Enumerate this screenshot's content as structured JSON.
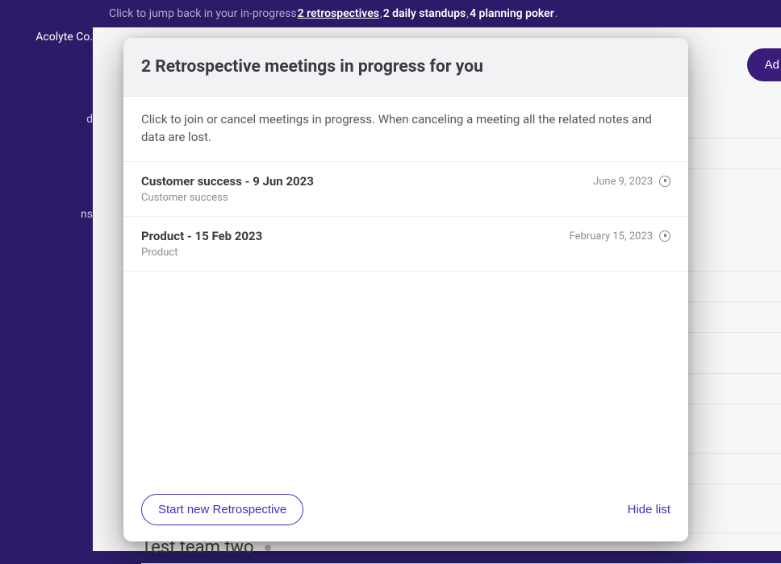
{
  "sidebar": {
    "org": "Acolyte Co.",
    "items": [
      "d",
      "ns"
    ]
  },
  "banner": {
    "prefix": "Click to jump back in your in-progress ",
    "retro": "2 retrospectives",
    "sep1": ", ",
    "standups": "2 daily standups",
    "sep2": ", ",
    "poker": "4 planning poker",
    "suffix": "."
  },
  "header": {
    "add_button": "Ad"
  },
  "background": {
    "team_label": "Test team two"
  },
  "modal": {
    "title": "2 Retrospective meetings in progress for you",
    "description": "Click to join or cancel meetings in progress. When canceling a meeting all the related notes and data are lost.",
    "meetings": [
      {
        "title": "Customer success - 9 Jun 2023",
        "team": "Customer success",
        "date": "June 9, 2023"
      },
      {
        "title": "Product - 15 Feb 2023",
        "team": "Product",
        "date": "February 15, 2023"
      }
    ],
    "start_label": "Start new Retrospective",
    "hide_label": "Hide list"
  }
}
